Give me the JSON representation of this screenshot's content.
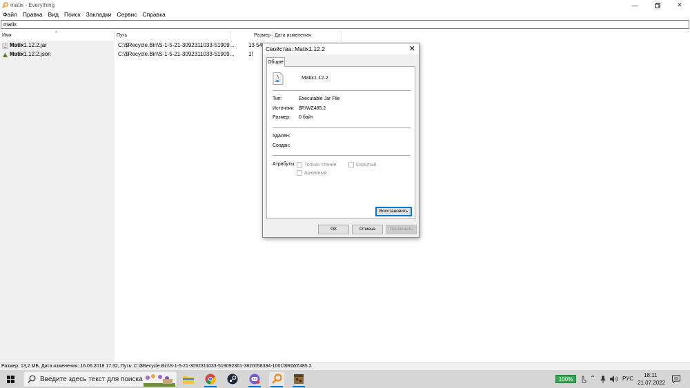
{
  "window": {
    "title": "matix - Everything"
  },
  "menu": [
    "Файл",
    "Правка",
    "Вид",
    "Поиск",
    "Закладки",
    "Сервис",
    "Справка"
  ],
  "search": {
    "value": "matix"
  },
  "columns": {
    "name": "Имя",
    "path": "Путь",
    "size": "Размер",
    "modified": "Дата изменения"
  },
  "results": [
    {
      "name_bold": "Matix",
      "name_rest": "1.12.2.jar",
      "path": "C:\\$Recycle.Bin\\S-1-5-21-3092311033-51909...",
      "size": "13 54",
      "icon": "jar-file-icon"
    },
    {
      "name_bold": "Matix",
      "name_rest": "1.12.2.json",
      "path": "C:\\$Recycle.Bin\\S-1-5-21-3092311033-51909...",
      "size": "1!",
      "icon": "json-file-icon"
    }
  ],
  "statusbar": "Размер: 13,2 МБ, Дата изменения: 16.06.2018 17:32, Путь: C:\\$Recycle.Bin\\S-1-5-21-3092311033-519092361-3820058334-1001\\$RIWZ485.2",
  "dialog": {
    "title": "Свойства: Matix1.12.2",
    "tab": "Общие",
    "filename": "Matix1.12.2",
    "type_label": "Тип:",
    "type_value": "Executable Jar File",
    "source_label": "Источник:",
    "source_value": "$RIWZ485.2",
    "size_label": "Размер:",
    "size_value": "0 байт",
    "deleted_label": "Удален:",
    "created_label": "Создан:",
    "attributes_label": "Атрибуты:",
    "readonly_label": "Только чтение",
    "hidden_label": "Скрытый",
    "archive_label": "Архивный",
    "restore_label": "Восстановить",
    "ok_label": "ОК",
    "cancel_label": "Отмена",
    "apply_label": "Применить"
  },
  "taskbar": {
    "search_placeholder": "Введите здесь текст для поиска",
    "battery": "100%",
    "lang": "РУС",
    "time": "18:11",
    "date": "21.07.2022"
  },
  "colors": {
    "accent": "#0078d7",
    "battery": "#32a852",
    "app_icon": "#f08a1c"
  }
}
